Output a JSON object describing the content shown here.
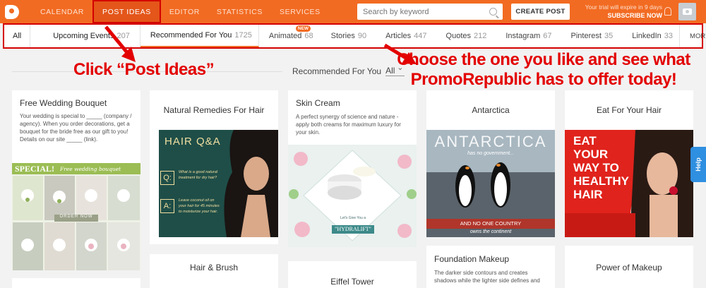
{
  "nav": {
    "items": [
      "CALENDAR",
      "POST IDEAS",
      "EDITOR",
      "STATISTICS",
      "SERVICES"
    ],
    "search_placeholder": "Search by keyword",
    "create_label": "CREATE POST",
    "trial_line1": "Your trial will expire in 9 days",
    "trial_line2": "SUBSCRIBE NOW"
  },
  "tabs": [
    {
      "label": "All",
      "count": ""
    },
    {
      "label": "Upcoming Events",
      "count": "207"
    },
    {
      "label": "Recommended For You",
      "count": "1725"
    },
    {
      "label": "Animated",
      "count": "68",
      "badge": "NEW"
    },
    {
      "label": "Stories",
      "count": "90"
    },
    {
      "label": "Articles",
      "count": "447"
    },
    {
      "label": "Quotes",
      "count": "212"
    },
    {
      "label": "Instagram",
      "count": "67"
    },
    {
      "label": "Pinterest",
      "count": "35"
    },
    {
      "label": "LinkedIn",
      "count": "33"
    }
  ],
  "more_label": "MORE",
  "filter": {
    "label": "Recommended For You",
    "value": "All"
  },
  "annotations": {
    "click": "Click “Post Ideas”",
    "choose": "Choose the one you like and see what PromoRepublic has to offer today!"
  },
  "cards": {
    "wedding": {
      "title": "Free Wedding Bouquet",
      "text": "Your wedding is special to _____ (company / agency). When you order decorations, get a bouquet for the bride free as our gift to you!",
      "details": "Details on our site _____ (link).",
      "banner": "SPECIAL!",
      "banner_script": "Free wedding bouquet",
      "order": "ORDER NOW"
    },
    "hair_remedies": {
      "title": "Natural Remedies For Hair",
      "img_title": "HAIR Q&A",
      "q_text": "What is a good natural treatment for dry hair?",
      "a_text": "Leave coconut oil on your hair for 45 minutes to moisturize your hair."
    },
    "skin_cream": {
      "title": "Skin Cream",
      "text": "A perfect synergy of science and nature - apply both creams for maximum luxury for your skin.",
      "img_small": "Let's Give You a",
      "img_label": "\"HYDRALIFT\""
    },
    "antarctica": {
      "title": "Antarctica",
      "img_title": "ANTARCTICA",
      "img_sub": "has no government...",
      "img_bottom": "AND NO ONE COUNTRY",
      "img_bottom2": "owns the continent"
    },
    "eat_hair": {
      "title": "Eat For Your Hair",
      "img_lines": [
        "EAT",
        "YOUR",
        "WAY TO",
        "HEALTHY",
        "HAIR"
      ]
    },
    "hair_brush": {
      "title": "Hair & Brush"
    },
    "eiffel": {
      "title": "Eiffel Tower"
    },
    "foundation": {
      "title": "Foundation Makeup",
      "text": "The darker side contours and creates shadows while the lighter side defines and"
    },
    "power": {
      "title": "Power of Makeup"
    }
  },
  "help_label": "Help",
  "colors": {
    "brand": "#f26b22",
    "highlight": "#d40000",
    "annotation": "#e30000"
  }
}
